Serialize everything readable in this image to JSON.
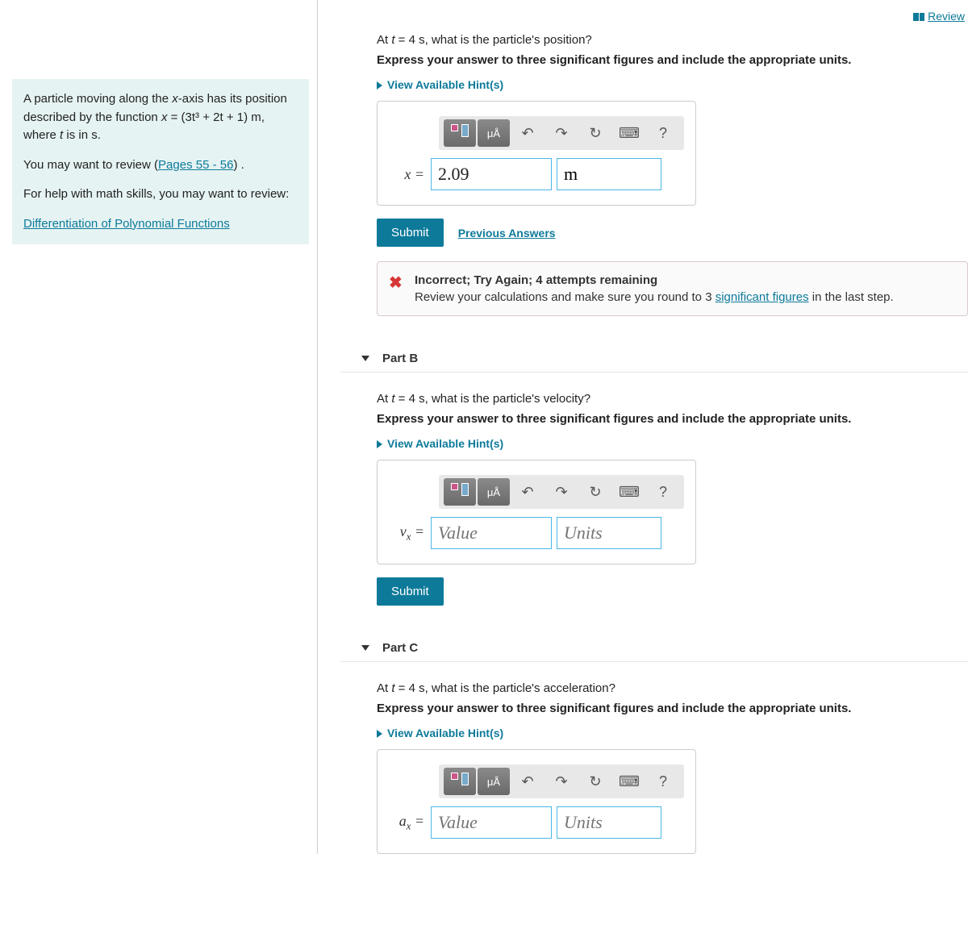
{
  "review_link": "Review",
  "info": {
    "p1_a": "A particle moving along the ",
    "p1_var1": "x",
    "p1_b": "-axis has its position described by the function ",
    "p1_var2": "x",
    "p1_eq": " = (3t³ + 2t + 1) m",
    "p1_c": ", where ",
    "p1_var3": "t",
    "p1_d": " is in s.",
    "p2_a": "You may want to review (",
    "p2_link": "Pages 55 - 56",
    "p2_b": ") .",
    "p3": "For help with math skills, you may want to review:",
    "p4_link": "Differentiation of Polynomial Functions"
  },
  "partA": {
    "q_a": "At ",
    "q_var": "t",
    "q_b": " = 4 s, what is the particle's position?",
    "instruction": "Express your answer to three significant figures and include the appropriate units.",
    "hints": "View Available Hint(s)",
    "var_label": "x =",
    "value": "2.09",
    "units": "m",
    "submit": "Submit",
    "prev": "Previous Answers",
    "fb_title": "Incorrect; Try Again; 4 attempts remaining",
    "fb_body_a": "Review your calculations and make sure you round to 3 ",
    "fb_link": "significant figures",
    "fb_body_b": " in the last step."
  },
  "partB": {
    "title": "Part B",
    "q_a": "At ",
    "q_var": "t",
    "q_b": " = 4 s, what is the particle's velocity?",
    "instruction": "Express your answer to three significant figures and include the appropriate units.",
    "hints": "View Available Hint(s)",
    "var_label_html": "vₓ =",
    "value_ph": "Value",
    "units_ph": "Units",
    "submit": "Submit"
  },
  "partC": {
    "title": "Part C",
    "q_a": "At ",
    "q_var": "t",
    "q_b": " = 4 s, what is the particle's acceleration?",
    "instruction": "Express your answer to three significant figures and include the appropriate units.",
    "hints": "View Available Hint(s)",
    "var_label_html": "aₓ =",
    "value_ph": "Value",
    "units_ph": "Units"
  },
  "toolbar": {
    "units_btn": "μÅ",
    "help": "?"
  }
}
